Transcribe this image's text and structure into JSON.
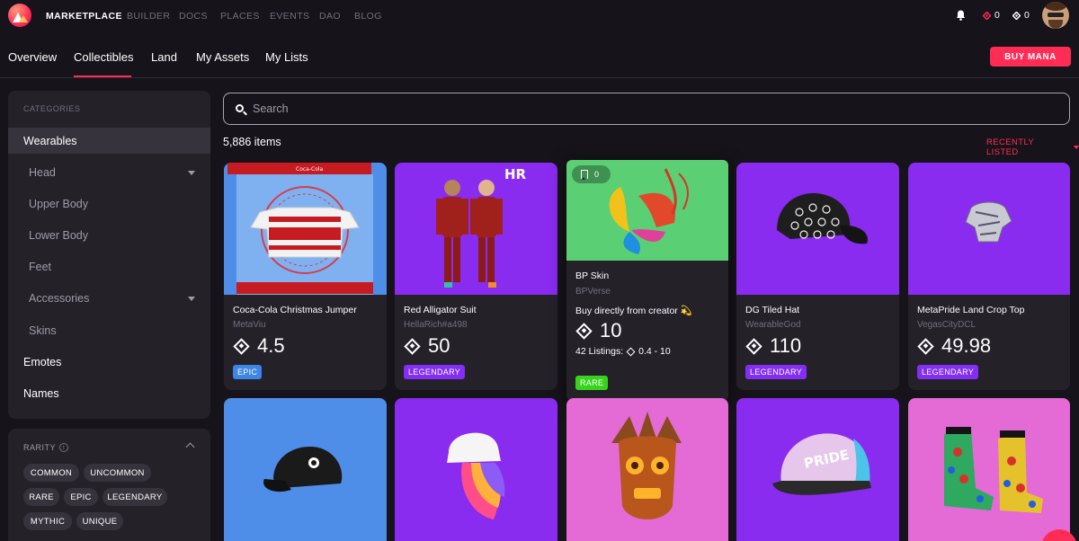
{
  "topnav": {
    "items": [
      "MARKETPLACE",
      "BUILDER",
      "DOCS",
      "PLACES",
      "EVENTS",
      "DAO",
      "BLOG"
    ],
    "mana_balance_1": "0",
    "mana_balance_2": "0"
  },
  "tabs": [
    "Overview",
    "Collectibles",
    "Land",
    "My Assets",
    "My Lists"
  ],
  "active_tab": "Collectibles",
  "buy_mana_label": "BUY MANA",
  "sidebar": {
    "categories_title": "CATEGORIES",
    "categories": [
      "Wearables",
      "Head",
      "Upper Body",
      "Lower Body",
      "Feet",
      "Accessories",
      "Skins",
      "Emotes",
      "Names"
    ],
    "rarity_title": "RARITY",
    "rarities": [
      "COMMON",
      "UNCOMMON",
      "RARE",
      "EPIC",
      "LEGENDARY",
      "MYTHIC",
      "UNIQUE"
    ]
  },
  "search": {
    "placeholder": "Search"
  },
  "results": {
    "count": "5,886 items",
    "sort": "RECENTLY LISTED"
  },
  "colors": {
    "accent": "#ff2d55",
    "epic": "#3d85e6",
    "legendary": "#842df4",
    "rare": "#36d41d"
  },
  "cards": [
    {
      "name": "Coca-Cola Christmas Jumper",
      "creator": "MetaViu",
      "price": "4.5",
      "rarity": "EPIC"
    },
    {
      "name": "Red Alligator Suit",
      "creator": "HellaRich#a498",
      "price": "50",
      "rarity": "LEGENDARY"
    },
    {
      "name": "BP Skin",
      "creator": "BPVerse",
      "price": "10",
      "rarity": "RARE",
      "bookmarks": "0",
      "buy_direct": "Buy directly from creator 💫",
      "listings_label": "42 Listings:",
      "listings_range": "0.4 - 10"
    },
    {
      "name": "DG Tiled Hat",
      "creator": "WearableGod",
      "price": "110",
      "rarity": "LEGENDARY"
    },
    {
      "name": "MetaPride Land Crop Top",
      "creator": "VegasCityDCL",
      "price": "49.98",
      "rarity": "LEGENDARY"
    }
  ],
  "thumb_text": {
    "coca_cola": "Coca-Cola",
    "hr_logo": "HR",
    "pride": "PRIDE"
  }
}
